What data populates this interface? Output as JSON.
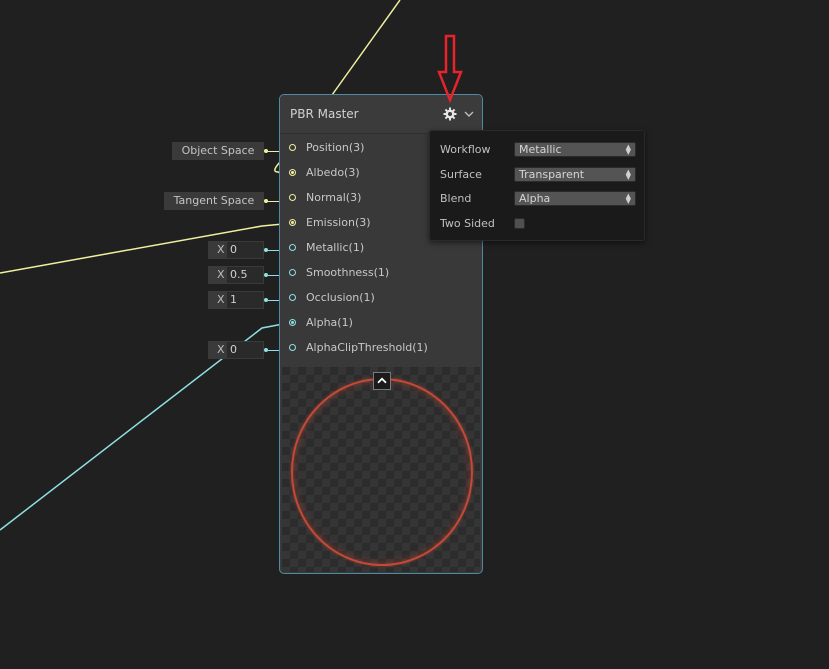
{
  "node": {
    "title": "PBR Master",
    "ports": [
      {
        "label": "Position(3)",
        "color": "#f0f0a0",
        "filled": false
      },
      {
        "label": "Albedo(3)",
        "color": "#f0f0a0",
        "filled": true
      },
      {
        "label": "Normal(3)",
        "color": "#f0f0a0",
        "filled": false
      },
      {
        "label": "Emission(3)",
        "color": "#f0f0a0",
        "filled": true
      },
      {
        "label": "Metallic(1)",
        "color": "#8ee0e4",
        "filled": false
      },
      {
        "label": "Smoothness(1)",
        "color": "#8ee0e4",
        "filled": false
      },
      {
        "label": "Occlusion(1)",
        "color": "#8ee0e4",
        "filled": false
      },
      {
        "label": "Alpha(1)",
        "color": "#8ee0e4",
        "filled": true
      },
      {
        "label": "AlphaClipThreshold(1)",
        "color": "#8ee0e4",
        "filled": false
      }
    ],
    "preview_tint": "#c24a38"
  },
  "defaults": {
    "position_space": "Object Space",
    "normal_space": "Tangent Space",
    "axis_label": "X",
    "metallic": "0",
    "smoothness": "0.5",
    "occlusion": "1",
    "alpha_clip": "0"
  },
  "settings": {
    "workflow_label": "Workflow",
    "workflow_value": "Metallic",
    "surface_label": "Surface",
    "surface_value": "Transparent",
    "blend_label": "Blend",
    "blend_value": "Alpha",
    "two_sided_label": "Two Sided",
    "two_sided_checked": false
  },
  "icons": {
    "gear": "gear-icon",
    "chevron": "chevron-down-icon",
    "collapse": "chevron-up-icon",
    "annotation": "red-arrow-icon"
  },
  "colors": {
    "vector3_wire": "#f0f0a0",
    "vector1_wire": "#8ee0e4",
    "node_border": "#4f8aa5",
    "annotation": "#e8232a"
  }
}
